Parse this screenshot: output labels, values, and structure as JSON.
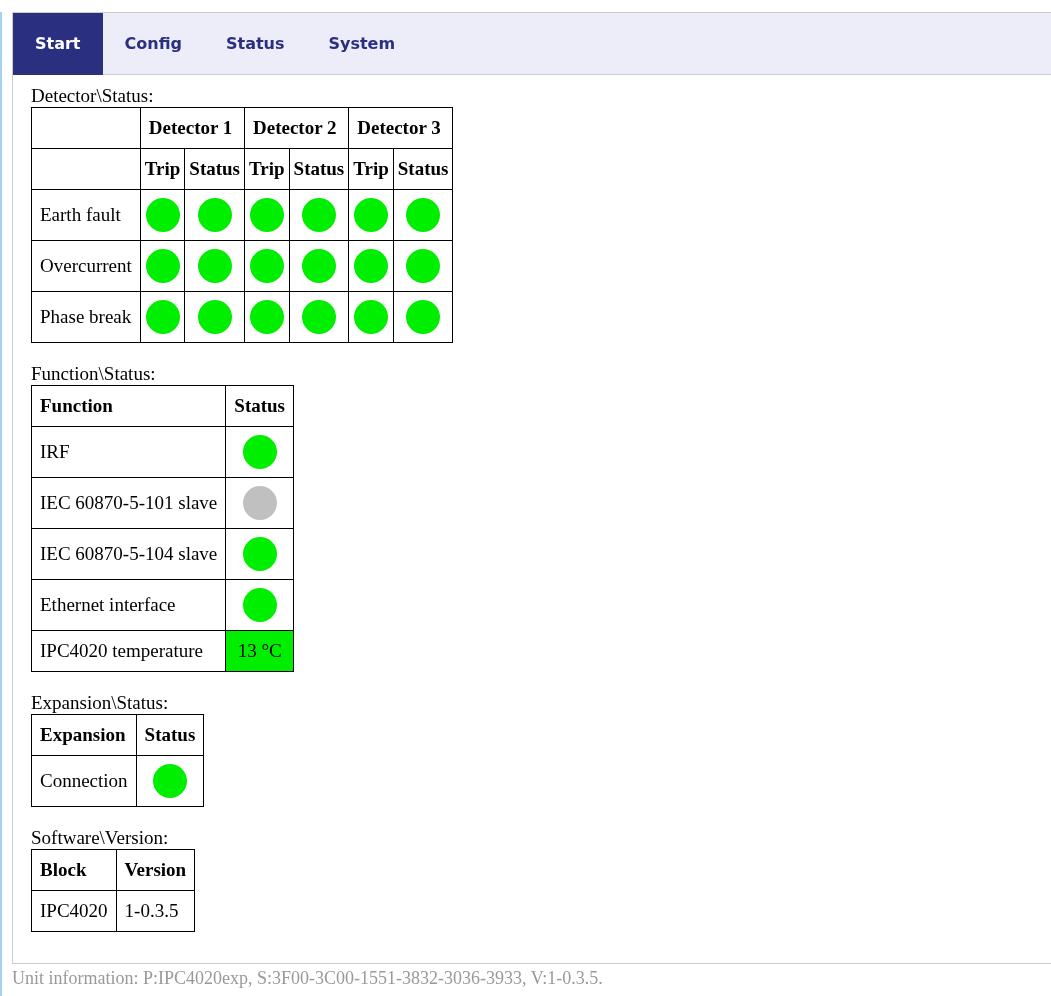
{
  "tabs": [
    {
      "label": "Start",
      "selected": true
    },
    {
      "label": "Config",
      "selected": false
    },
    {
      "label": "Status",
      "selected": false
    },
    {
      "label": "System",
      "selected": false
    }
  ],
  "detector_status": {
    "title": "Detector\\Status:",
    "detectors": [
      "Detector 1",
      "Detector 2",
      "Detector 3"
    ],
    "subheaders": [
      "Trip",
      "Status",
      "Trip",
      "Status",
      "Trip",
      "Status"
    ],
    "rows": [
      {
        "label": "Earth fault",
        "indicators": [
          {
            "color": "#00ee00"
          },
          {
            "color": "#00ee00"
          },
          {
            "color": "#00ee00"
          },
          {
            "color": "#00ee00"
          },
          {
            "color": "#00ee00"
          },
          {
            "color": "#00ee00"
          }
        ]
      },
      {
        "label": "Overcurrent",
        "indicators": [
          {
            "color": "#00ee00"
          },
          {
            "color": "#00ee00"
          },
          {
            "color": "#00ee00"
          },
          {
            "color": "#00ee00"
          },
          {
            "color": "#00ee00"
          },
          {
            "color": "#00ee00"
          }
        ]
      },
      {
        "label": "Phase break",
        "indicators": [
          {
            "color": "#00ee00"
          },
          {
            "color": "#00ee00"
          },
          {
            "color": "#00ee00"
          },
          {
            "color": "#00ee00"
          },
          {
            "color": "#00ee00"
          },
          {
            "color": "#00ee00"
          }
        ]
      }
    ]
  },
  "function_status": {
    "title": "Function\\Status:",
    "columns": [
      "Function",
      "Status"
    ],
    "rows": [
      {
        "label": "IRF",
        "kind": "dot",
        "color": "#00ee00"
      },
      {
        "label": "IEC 60870-5-101 slave",
        "kind": "dot",
        "color": "#c0c0c0"
      },
      {
        "label": "IEC 60870-5-104 slave",
        "kind": "dot",
        "color": "#00ee00"
      },
      {
        "label": "Ethernet interface",
        "kind": "dot",
        "color": "#00ee00"
      },
      {
        "label": "IPC4020 temperature",
        "kind": "reading",
        "value": "13 °C",
        "color": "#00ee00"
      }
    ]
  },
  "expansion_status": {
    "title": "Expansion\\Status:",
    "columns": [
      "Expansion",
      "Status"
    ],
    "rows": [
      {
        "label": "Connection",
        "kind": "dot",
        "color": "#00ee00"
      }
    ]
  },
  "software_version": {
    "title": "Software\\Version:",
    "columns": [
      "Block",
      "Version"
    ],
    "rows": [
      {
        "block": "IPC4020",
        "version": "1-0.3.5"
      }
    ]
  },
  "footer": "Unit information: P:IPC4020exp, S:3F00-3C00-1551-3832-3036-3933, V:1-0.3.5."
}
